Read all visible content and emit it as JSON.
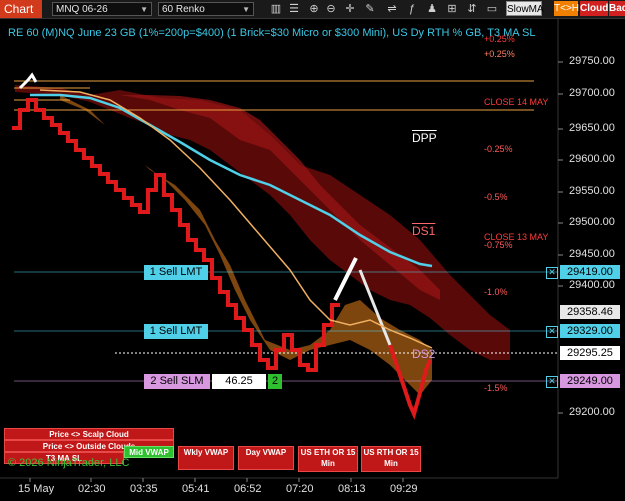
{
  "toolbar": {
    "title": "Chart",
    "instrument": "MNQ 06-26",
    "interval": "60 Renko",
    "slowma_label": "SlowMA",
    "tch_label": "T<>H",
    "cloud_label": "Cloud",
    "bad_label": "Bad"
  },
  "chart_title": "RE 60 (M)NQ June 23 GB (1%=200p=$400) (1 Brick=$30 Micro or $300 Mini), US Dy RTH % GB, T3 MA SL",
  "price_axis": [
    "29750.00",
    "29700.00",
    "29650.00",
    "29600.00",
    "29550.00",
    "29500.00",
    "29450.00",
    "29400.00",
    "29200.00"
  ],
  "time_axis": [
    "15 May",
    "02:30",
    "03:35",
    "05:41",
    "06:52",
    "07:20",
    "08:13",
    "09:29"
  ],
  "price_tags": {
    "sell1": "29419.00",
    "level_a": "29358.46",
    "sell2": "29329.00",
    "last": "29295.25",
    "sell3": "29249.00"
  },
  "orders": {
    "sell_lmt_1": "1 Sell LMT",
    "sell_lmt_2": "1 Sell LMT",
    "sell_slm": "2 Sell SLM",
    "slm_price": "46.25",
    "slm_qty": "2"
  },
  "annotations": {
    "close_14": "CLOSE 14 MAY",
    "close_13": "CLOSE 13 MAY",
    "dpp": "DPP",
    "ds1": "DS1",
    "ds2": "DS2",
    "pct_pos_025": "+0.25%",
    "pct_neg_025": "-0.25%",
    "pct_neg_05": "-0.5%",
    "pct_neg_075": "-0.75%",
    "pct_neg_10": "-1.0%",
    "pct_neg_15": "-1.5%"
  },
  "buttons": {
    "scalp_cloud": "Price <> Scalp Cloud",
    "outside_clouds": "Price <> Outside Clouds",
    "t3_ma_sl": "T3 MA SL",
    "mid_vwap": "Mid VWAP",
    "wkly_vwap": "Wkly VWAP",
    "day_vwap": "Day VWAP",
    "us_eth": "US ETH OR 15 Min",
    "us_rth": "US RTH OR 15 Min"
  },
  "copyright": "© 2026 NinjaTrader, LLC",
  "colors": {
    "accent_red": "#d13b1c",
    "cyan": "#4fd0e8",
    "brick_red": "#e01a1a",
    "cloud_dark_red": "#8a1010",
    "orange": "#e8a040",
    "green": "#2ec02e",
    "pink": "#d898e0"
  },
  "chart_data": {
    "type": "line",
    "title": "",
    "xlabel": "",
    "ylabel": "",
    "x": [
      "15 May",
      "02:30",
      "03:35",
      "05:41",
      "06:52",
      "07:20",
      "08:13",
      "09:29"
    ],
    "ylim": [
      29180,
      29780
    ],
    "series": [
      {
        "values": [
          29700,
          29640,
          29560,
          29520,
          29380,
          29300,
          29430,
          29220,
          29295
        ]
      }
    ]
  }
}
